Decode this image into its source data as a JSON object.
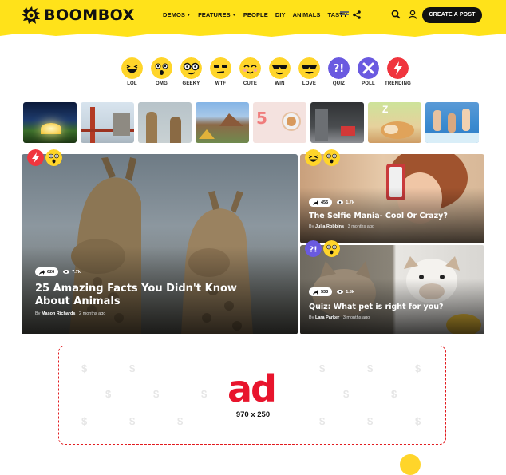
{
  "brand": {
    "name": "BOOMBOX",
    "accent": "#ffe21a"
  },
  "nav": {
    "items": [
      {
        "label": "DEMOS",
        "dropdown": true
      },
      {
        "label": "FEATURES",
        "dropdown": true
      },
      {
        "label": "PEOPLE",
        "dropdown": false
      },
      {
        "label": "DIY",
        "dropdown": false
      },
      {
        "label": "ANIMALS",
        "dropdown": false
      },
      {
        "label": "TASTY",
        "dropdown": false
      }
    ],
    "create_label": "CREATE A POST",
    "icons": [
      "menu-icon",
      "share-icon",
      "search-icon",
      "user-icon"
    ]
  },
  "reactions": [
    {
      "label": "LOL",
      "icon": "lol-face",
      "color": "#ffd52a"
    },
    {
      "label": "OMG",
      "icon": "omg-face",
      "color": "#ffd52a"
    },
    {
      "label": "GEEKY",
      "icon": "geeky-face",
      "color": "#ffd52a"
    },
    {
      "label": "WTF",
      "icon": "wtf-face",
      "color": "#ffd52a"
    },
    {
      "label": "CUTE",
      "icon": "cute-face",
      "color": "#ffd52a"
    },
    {
      "label": "WIN",
      "icon": "win-face",
      "color": "#ffd52a"
    },
    {
      "label": "LOVE",
      "icon": "love-face",
      "color": "#ffd52a"
    },
    {
      "label": "QUIZ",
      "icon": "quiz-icon",
      "color": "#6a5ae0"
    },
    {
      "label": "POLL",
      "icon": "poll-icon",
      "color": "#6a5ae0"
    },
    {
      "label": "TRENDING",
      "icon": "trending-icon",
      "color": "#f0353e"
    }
  ],
  "thumbnails": [
    "tent-night-thumb",
    "golden-gate-thumb",
    "giraffes-thumb",
    "tents-camp-thumb",
    "cookies-thumb",
    "city-crossing-thumb",
    "sleeping-dog-thumb",
    "pool-jump-thumb",
    "food-thumb"
  ],
  "posts": {
    "featured": {
      "title_line1": "25 Amazing Facts You Didn't Know",
      "title_line2": "About Animals",
      "shares": "626",
      "views": "7.7k",
      "author_prefix": "By",
      "author": "Mason Richards",
      "time": "2 months ago",
      "badges": [
        "trending-badge",
        "omg-badge"
      ]
    },
    "side1": {
      "title": "The Selfie Mania- Cool Or Crazy?",
      "shares": "455",
      "views": "1.7k",
      "author_prefix": "By",
      "author": "Julia Robbins",
      "time": "3 months ago",
      "badges": [
        "lol-badge",
        "omg-badge"
      ]
    },
    "side2": {
      "title": "Quiz: What pet is right for you?",
      "shares": "533",
      "views": "1.8k",
      "author_prefix": "By",
      "author": "Lara Parker",
      "time": "3 months ago",
      "badges": [
        "quiz-badge",
        "omg-badge"
      ]
    }
  },
  "ad": {
    "logo": "ad",
    "size": "970 x 250",
    "dollar": "$",
    "color": "#e8152d"
  }
}
